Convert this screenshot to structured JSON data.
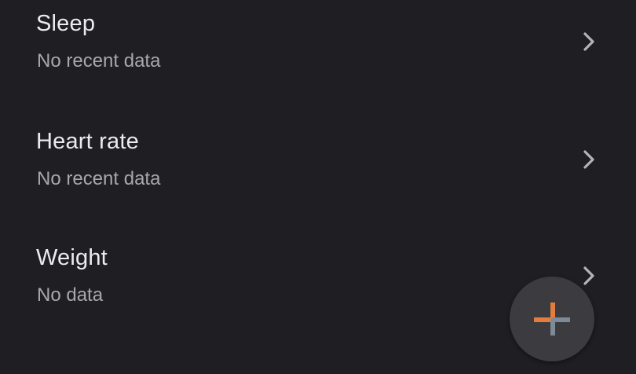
{
  "metrics": [
    {
      "title": "Sleep",
      "status": "No recent data",
      "chevron_icon": "chevron-right-icon"
    },
    {
      "title": "Heart rate",
      "status": "No recent data",
      "chevron_icon": "chevron-right-icon"
    },
    {
      "title": "Weight",
      "status": "No data",
      "chevron_icon": "chevron-right-icon"
    }
  ],
  "fab": {
    "icon": "add-icon",
    "colors": {
      "orange": "#e27d3e",
      "gray": "#7f8a97",
      "background": "#3b3b40"
    }
  },
  "colors": {
    "background": "#1f1f23",
    "title_text": "#ececef",
    "status_text": "#a7a7ad",
    "chevron": "#b3b3b8"
  }
}
